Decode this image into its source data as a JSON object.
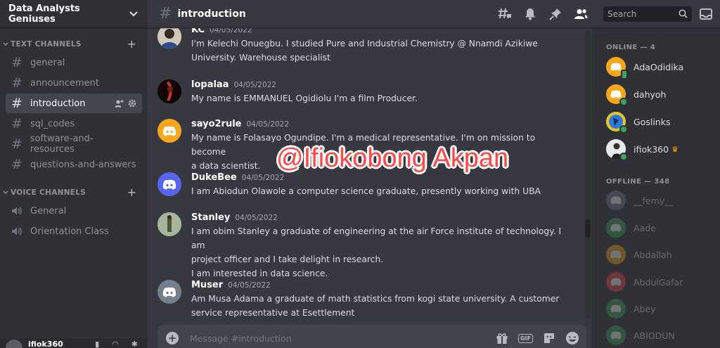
{
  "server": {
    "name": "Data Analysts Geniuses"
  },
  "text_category": "TEXT CHANNELS",
  "voice_category": "VOICE CHANNELS",
  "text_channels": [
    {
      "name": "general"
    },
    {
      "name": "announcement"
    },
    {
      "name": "introduction"
    },
    {
      "name": "sql_codes"
    },
    {
      "name": "software-and-resources"
    },
    {
      "name": "questions-and-answers"
    }
  ],
  "voice_channels": [
    {
      "name": "General"
    },
    {
      "name": "Orientation Class"
    }
  ],
  "current_user": {
    "name": "ifiok360"
  },
  "topbar": {
    "channel": "introduction",
    "search_placeholder": "Search"
  },
  "messages": [
    {
      "author": "KC",
      "date": "04/05/2022",
      "text": "I'm Kelechi Onuegbu. I studied Pure and Industrial Chemistry @ Nnamdi Azikiwe\nUniversity. Warehouse specialist"
    },
    {
      "author": "lopalaa",
      "date": "04/05/2022",
      "text": "My name is EMMANUEL Ogidiolu I'm a film Producer."
    },
    {
      "author": "sayo2rule",
      "date": "04/05/2022",
      "text": "My name is Folasayo Ogundipe. I'm a medical representative. I'm on mission to become\na data scientist."
    },
    {
      "author": "DukeBee",
      "date": "04/05/2022",
      "text": "I am Abiodun Olawole a computer science graduate, presently working with UBA"
    },
    {
      "author": "Stanley",
      "date": "04/05/2022",
      "text": "I am obim Stanley a graduate of engineering at the air Force institute of technology. I am\nproject officer and I take delight in research.\nI am interested in data science."
    },
    {
      "author": "Muser",
      "date": "04/05/2022",
      "text": "Am Musa Adama a graduate of math statistics from kogi state university. A customer\nservice representative at Esettlement"
    }
  ],
  "composer": {
    "placeholder": "Message #introduction"
  },
  "members": {
    "online_label": "ONLINE — 4",
    "offline_label": "OFFLINE — 348",
    "online": [
      {
        "name": "AdaOdidika"
      },
      {
        "name": "dahyoh"
      },
      {
        "name": "Goslinks"
      },
      {
        "name": "ifiok360"
      }
    ],
    "offline": [
      {
        "name": "__femy__"
      },
      {
        "name": "Aade"
      },
      {
        "name": "Abdallah"
      },
      {
        "name": "AbdulGafar"
      },
      {
        "name": "Abey"
      },
      {
        "name": "ABIODUN"
      }
    ]
  },
  "watermark": "@Ifiokobong Akpan",
  "colors": {
    "blurple": "#5865f2",
    "orange": "#faa61a",
    "red": "#ed4245",
    "green": "#3ba55d",
    "grey": "#747f8d"
  }
}
